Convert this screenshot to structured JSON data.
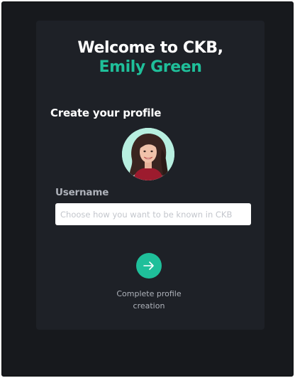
{
  "welcome": {
    "title_prefix": "Welcome to CKB,",
    "user_name": "Emily Green"
  },
  "profile": {
    "heading": "Create your profile",
    "avatar_icon": "user-photo-icon",
    "username_label": "Username",
    "username_value": "",
    "username_placeholder": "Choose how you want to be known in CKB"
  },
  "actions": {
    "next_icon": "arrow-right-icon",
    "complete_caption": "Complete profile creation"
  },
  "colors": {
    "accent": "#1fbf9a",
    "background": "#17191d",
    "card": "#1e2127",
    "muted_text": "#aeb2ba"
  }
}
